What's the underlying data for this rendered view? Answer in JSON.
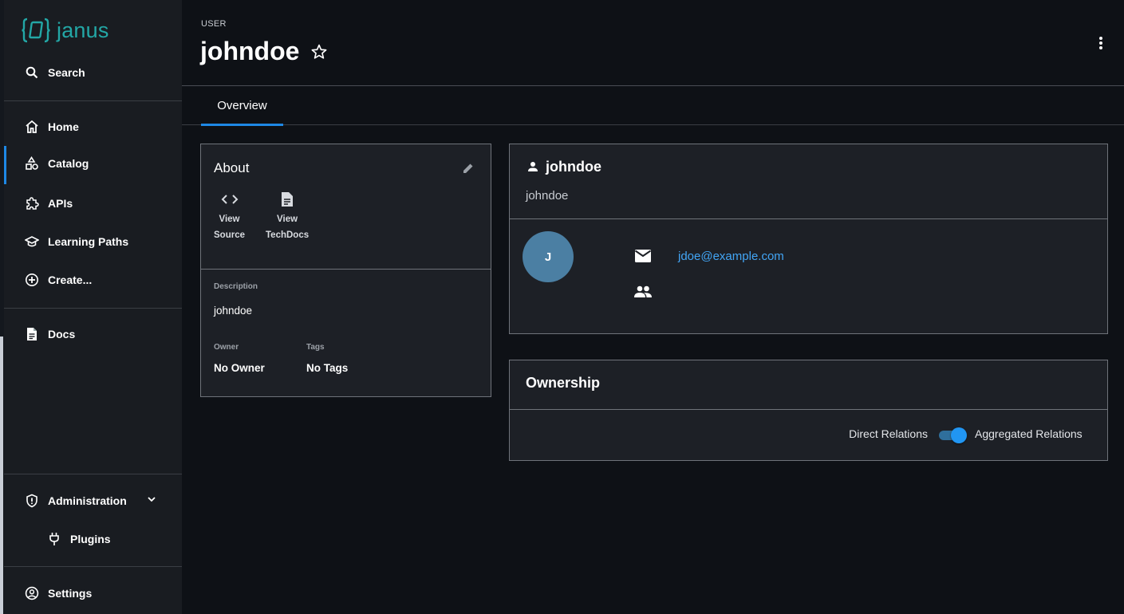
{
  "brand": {
    "name": "janus",
    "color": "#23a7a6"
  },
  "sidebar": {
    "search_label": "Search",
    "items": [
      {
        "label": "Home",
        "icon": "home-icon"
      },
      {
        "label": "Catalog",
        "icon": "catalog-icon",
        "active": true
      },
      {
        "label": "APIs",
        "icon": "puzzle-icon"
      },
      {
        "label": "Learning Paths",
        "icon": "school-icon"
      },
      {
        "label": "Create...",
        "icon": "add-circle-icon"
      }
    ],
    "docs_label": "Docs",
    "administration_label": "Administration",
    "plugins_label": "Plugins",
    "settings_label": "Settings"
  },
  "header": {
    "kind": "USER",
    "title": "johndoe"
  },
  "tabs": [
    {
      "label": "Overview",
      "selected": true
    }
  ],
  "about": {
    "title": "About",
    "view_source_line1": "View",
    "view_source_line2": "Source",
    "view_techdocs_line1": "View",
    "view_techdocs_line2": "TechDocs",
    "description_label": "Description",
    "description_value": "johndoe",
    "owner_label": "Owner",
    "owner_value": "No Owner",
    "tags_label": "Tags",
    "tags_value": "No Tags"
  },
  "user_card": {
    "title": "johndoe",
    "subtitle": "johndoe",
    "avatar_initial": "J",
    "email": "jdoe@example.com",
    "accent": "#42a5f5"
  },
  "ownership": {
    "title": "Ownership",
    "direct_label": "Direct Relations",
    "aggregated_label": "Aggregated Relations",
    "aggregated_enabled": true
  }
}
